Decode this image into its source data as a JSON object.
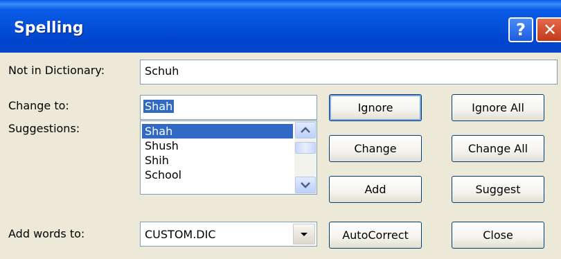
{
  "window": {
    "title": "Spelling",
    "help_glyph": "?",
    "close_glyph": "✕"
  },
  "not_in_dictionary": {
    "label": "Not in Dictionary:",
    "value": "Schuh"
  },
  "change_to": {
    "label": "Change to:",
    "value": "Shah"
  },
  "suggestions": {
    "label": "Suggestions:",
    "items": [
      "Shah",
      "Shush",
      "Shih",
      "School"
    ],
    "selected": "Shah"
  },
  "add_words_to": {
    "label": "Add words to:",
    "value": "CUSTOM.DIC"
  },
  "buttons": {
    "ignore": "Ignore",
    "ignore_all": "Ignore All",
    "change": "Change",
    "change_all": "Change All",
    "add": "Add",
    "suggest": "Suggest",
    "autocorrect": "AutoCorrect",
    "close": "Close"
  },
  "colors": {
    "title_bar": "#0a5ce8",
    "dialog_bg": "#ece9d8",
    "selection": "#316ac5",
    "close_button": "#d34c2a"
  },
  "icons": [
    "help-icon",
    "close-icon",
    "scroll-up-icon",
    "scroll-down-icon",
    "dropdown-arrow-icon"
  ]
}
